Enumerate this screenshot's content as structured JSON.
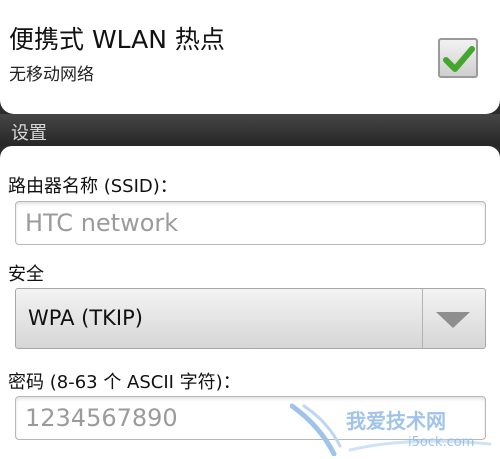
{
  "hotspot": {
    "title": "便携式 WLAN 热点",
    "status": "无移动网络",
    "checked": true
  },
  "settings_section": {
    "title": "设置"
  },
  "form": {
    "ssid": {
      "label": "路由器名称 (SSID)：",
      "value": "HTC network"
    },
    "security": {
      "label": "安全",
      "selected": "WPA (TKIP)"
    },
    "password": {
      "label": "密码 (8-63 个 ASCII 字符)：",
      "value": "1234567890"
    }
  },
  "watermark": {
    "cn_text": "我爱技术网",
    "url_text": "i5ock.com"
  },
  "colors": {
    "check_green": "#43a72e",
    "header_bg": "#2b2b2b",
    "card_bg": "#ffffff"
  }
}
